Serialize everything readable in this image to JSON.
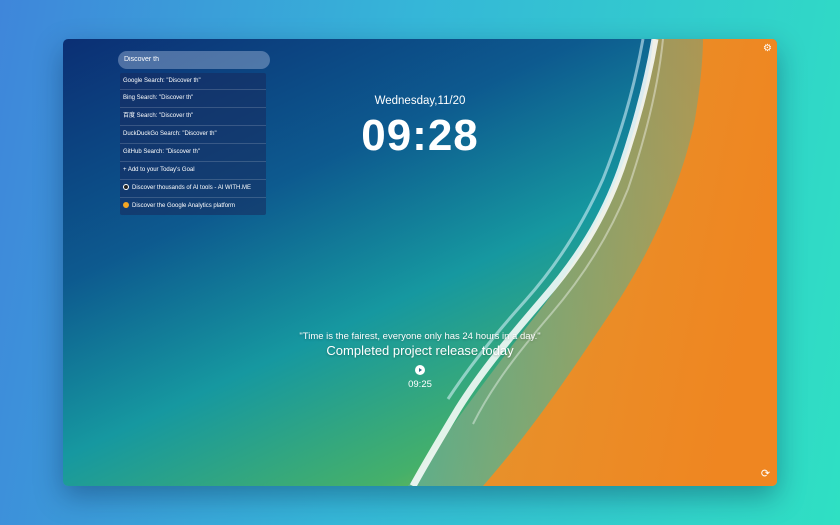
{
  "search": {
    "value": "Discover th",
    "suggestions": [
      "Google Search: \"Discover th\"",
      "Bing Search: \"Discover th\"",
      "百度 Search: \"Discover th\"",
      "DuckDuckGo Search: \"Discover th\"",
      "GitHub Search: \"Discover th\"",
      "+ Add to your Today's Goal",
      "Discover thousands of AI tools - AI WITH.ME",
      "Discover the Google Analytics platform"
    ]
  },
  "date": "Wednesday,11/20",
  "time": "09:28",
  "quote": "\"Time is the fairest, everyone only has 24 hours in a day.\"",
  "goal": "Completed project release today",
  "timer": "09:25",
  "icons": {
    "settings": "gear-icon",
    "play": "play-icon",
    "refresh": "refresh-icon"
  },
  "colors": {
    "ocean_deep": "#0c3d7e",
    "ocean_teal": "#1a9a9c",
    "sand": "#e78a22",
    "foam": "#ffffff"
  }
}
